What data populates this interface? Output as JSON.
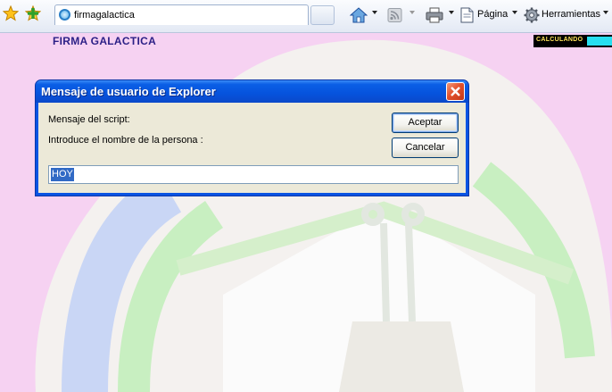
{
  "browser": {
    "tab_title": "firmagalactica",
    "commands": {
      "page_label": "Página",
      "tools_label": "Herramientas"
    }
  },
  "page": {
    "brand": "FIRMA GALACTICA",
    "calc_label": "CALCULANDO",
    "background_color": "#f6d2f2"
  },
  "dialog": {
    "title": "Mensaje de usuario de Explorer",
    "script_label": "Mensaje del script:",
    "prompt": "Introduce el nombre de la persona :",
    "accept_label": "Aceptar",
    "cancel_label": "Cancelar",
    "input_value": "HOY"
  },
  "colors": {
    "titlebar": "#0a54e3",
    "close": "#e2512c",
    "brand_text": "#2b1f86",
    "selection": "#316ac5"
  }
}
